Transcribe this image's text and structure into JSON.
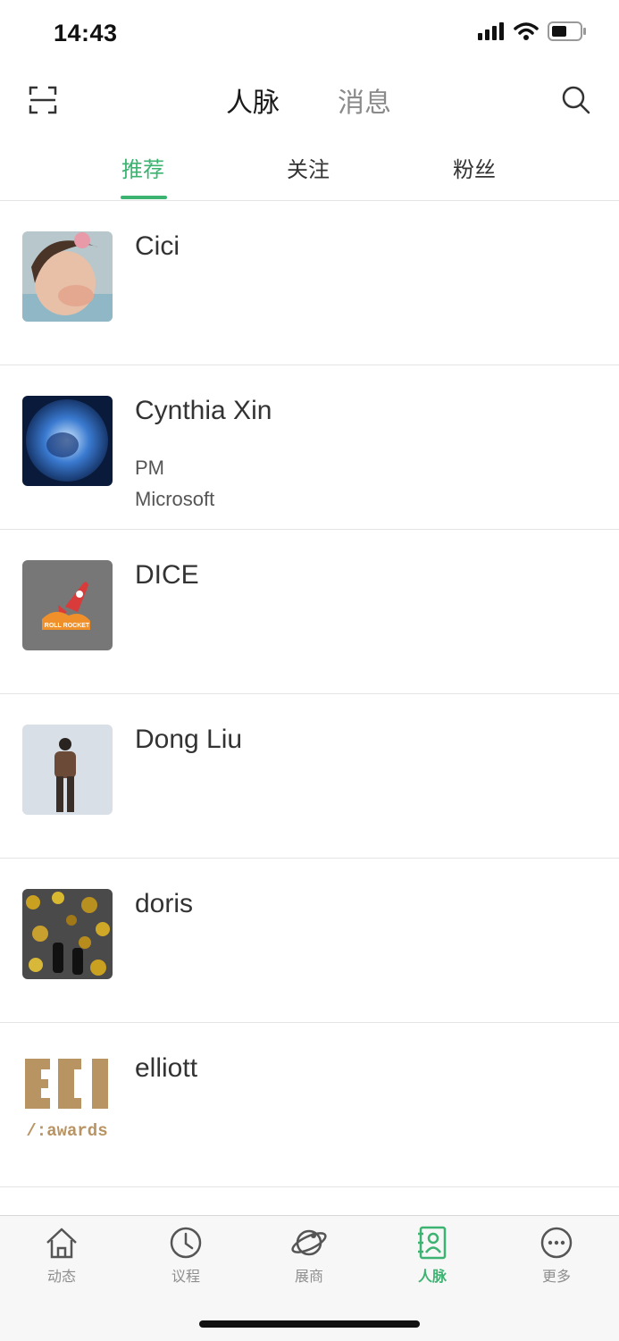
{
  "status_bar": {
    "time": "14:43"
  },
  "header": {
    "tabs": [
      {
        "label": "人脉",
        "active": true
      },
      {
        "label": "消息",
        "active": false
      }
    ]
  },
  "sub_tabs": [
    {
      "label": "推荐",
      "active": true
    },
    {
      "label": "关注",
      "active": false
    },
    {
      "label": "粉丝",
      "active": false
    }
  ],
  "contacts": [
    {
      "name": "Cici",
      "title": "",
      "company": ""
    },
    {
      "name": "Cynthia Xin",
      "title": "PM",
      "company": "Microsoft"
    },
    {
      "name": "DICE",
      "title": "",
      "company": "",
      "avatar_text": "ROLL ROCKET"
    },
    {
      "name": "Dong Liu",
      "title": "",
      "company": ""
    },
    {
      "name": "doris",
      "title": "",
      "company": ""
    },
    {
      "name": "elliott",
      "title": "",
      "company": "",
      "avatar_text": "/:awards"
    }
  ],
  "tab_bar": {
    "items": [
      {
        "label": "动态",
        "icon": "home-icon",
        "active": false
      },
      {
        "label": "议程",
        "icon": "clock-icon",
        "active": false
      },
      {
        "label": "展商",
        "icon": "planet-icon",
        "active": false
      },
      {
        "label": "人脉",
        "icon": "contacts-icon",
        "active": true
      },
      {
        "label": "更多",
        "icon": "more-icon",
        "active": false
      }
    ]
  },
  "colors": {
    "accent": "#3cb371",
    "divider": "#e3e3e3",
    "inactive": "#8e8e8e"
  }
}
